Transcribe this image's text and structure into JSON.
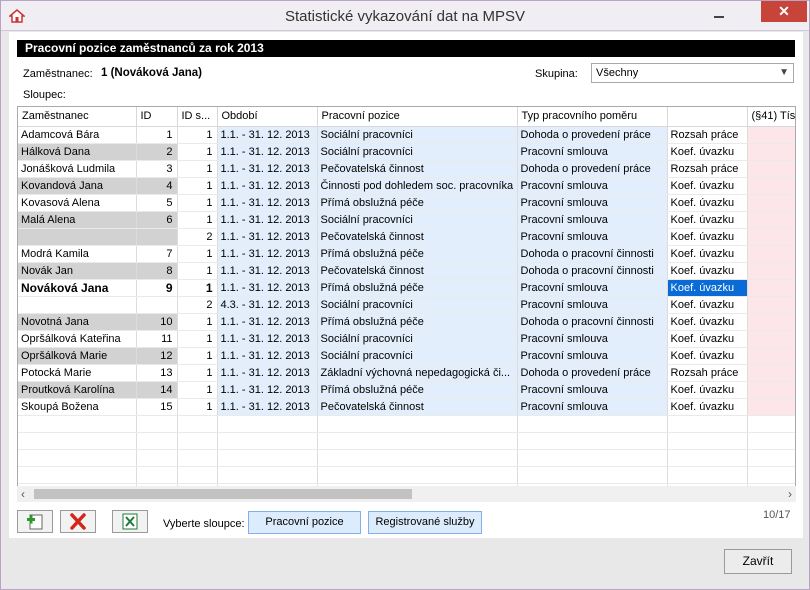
{
  "window": {
    "title": "Statistické vykazování dat na MPSV",
    "close_glyph": "✕"
  },
  "section_title": "Pracovní pozice zaměstnanců za rok 2013",
  "employee": {
    "label": "Zaměstnanec:",
    "value": "1 (Nováková Jana)"
  },
  "group": {
    "label": "Skupina:",
    "selected": "Všechny"
  },
  "columns_label": "Sloupec:",
  "table": {
    "headers": [
      "Zaměstnanec",
      "ID",
      "ID s...",
      "Období",
      "Pracovní pozice",
      "Typ pracovního poměru",
      "",
      "(§41) Tís"
    ],
    "rows": [
      [
        "Adamcová Bára",
        "1",
        "1",
        "1.1. - 31. 12. 2013",
        "Sociální pracovníci",
        "Dohoda o provedení práce",
        "Rozsah práce"
      ],
      [
        "Hálková Dana",
        "2",
        "1",
        "1.1. - 31. 12. 2013",
        "Sociální pracovníci",
        "Pracovní smlouva",
        "Koef. úvazku"
      ],
      [
        "Jonášková Ludmila",
        "3",
        "1",
        "1.1. - 31. 12. 2013",
        "Pečovatelská činnost",
        "Dohoda o provedení práce",
        "Rozsah práce"
      ],
      [
        "Kovandová Jana",
        "4",
        "1",
        "1.1. - 31. 12. 2013",
        "Činnosti pod dohledem soc. pracovníka",
        "Pracovní smlouva",
        "Koef. úvazku"
      ],
      [
        "Kovasová Alena",
        "5",
        "1",
        "1.1. - 31. 12. 2013",
        "Přímá obslužná péče",
        "Pracovní smlouva",
        "Koef. úvazku"
      ],
      [
        "Malá Alena",
        "6",
        "1",
        "1.1. - 31. 12. 2013",
        "Sociální pracovníci",
        "Pracovní smlouva",
        "Koef. úvazku"
      ],
      [
        "",
        "",
        "2",
        "1.1. - 31. 12. 2013",
        "Pečovatelská činnost",
        "Pracovní smlouva",
        "Koef. úvazku"
      ],
      [
        "Modrá Kamila",
        "7",
        "1",
        "1.1. - 31. 12. 2013",
        "Přímá obslužná péče",
        "Dohoda o pracovní činnosti",
        "Koef. úvazku"
      ],
      [
        "Novák Jan",
        "8",
        "1",
        "1.1. - 31. 12. 2013",
        "Pečovatelská činnost",
        "Dohoda o pracovní činnosti",
        "Koef. úvazku"
      ],
      [
        "Nováková Jana",
        "9",
        "1",
        "1.1. - 31. 12. 2013",
        "Přímá obslužná péče",
        "Pracovní smlouva",
        "Koef. úvazku"
      ],
      [
        "",
        "",
        "2",
        "4.3. - 31. 12. 2013",
        "Sociální pracovníci",
        "Pracovní smlouva",
        "Koef. úvazku"
      ],
      [
        "Novotná Jana",
        "10",
        "1",
        "1.1. - 31. 12. 2013",
        "Přímá obslužná péče",
        "Dohoda o pracovní činnosti",
        "Koef. úvazku"
      ],
      [
        "Opršálková Kateřina",
        "11",
        "1",
        "1.1. - 31. 12. 2013",
        "Sociální pracovníci",
        "Pracovní smlouva",
        "Koef. úvazku"
      ],
      [
        "Opršálková Marie",
        "12",
        "1",
        "1.1. - 31. 12. 2013",
        "Sociální pracovníci",
        "Pracovní smlouva",
        "Koef. úvazku"
      ],
      [
        "Potocká Marie",
        "13",
        "1",
        "1.1. - 31. 12. 2013",
        "Základní výchovná nepedagogická či...",
        "Dohoda o provedení práce",
        "Rozsah práce"
      ],
      [
        "Proutková Karolína",
        "14",
        "1",
        "1.1. - 31. 12. 2013",
        "Přímá obslužná péče",
        "Pracovní smlouva",
        "Koef. úvazku"
      ],
      [
        "Skoupá Božena",
        "15",
        "1",
        "1.1. - 31. 12. 2013",
        "Pečovatelská činnost",
        "Pracovní smlouva",
        "Koef. úvazku"
      ]
    ]
  },
  "toolbar": {
    "select_columns_label": "Vyberte sloupce:",
    "btn_positions": "Pracovní pozice",
    "btn_services": "Registrované služby",
    "counter": "10/17"
  },
  "close_button": "Zavřít",
  "colors": {
    "accent": "#0a6ad6",
    "blue_cell": "#e2eefb",
    "pink_cell": "#fde6ea",
    "close_red": "#c7443a"
  }
}
